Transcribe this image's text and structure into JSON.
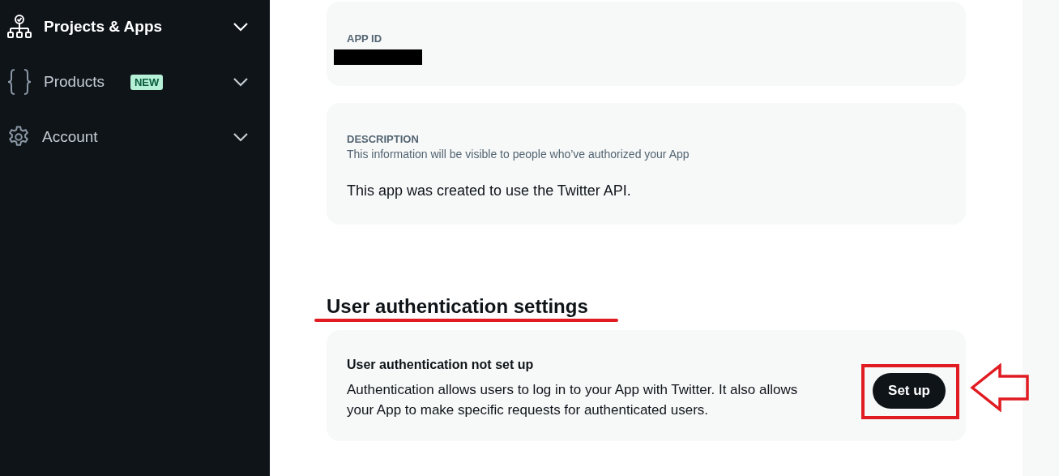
{
  "sidebar": {
    "items": [
      {
        "label": "Projects & Apps",
        "kind": "hierarchy",
        "selected": true
      },
      {
        "label": "Products",
        "kind": "braces",
        "badge": "NEW",
        "selected": false
      },
      {
        "label": "Account",
        "kind": "gear",
        "selected": false
      }
    ]
  },
  "app_id": {
    "label": "APP ID",
    "redacted": true
  },
  "description": {
    "label": "DESCRIPTION",
    "hint": "This information will be visible to people who’ve authorized your App",
    "value": "This app was created to use the Twitter API."
  },
  "user_auth": {
    "heading": "User authentication settings",
    "status_title": "User authentication not set up",
    "text": "Authentication allows users to log in to your App with Twitter. It also allows your App to make specific requests for authenticated users.",
    "button": "Set up"
  },
  "annotations": {
    "underline": true,
    "button_frame": true,
    "arrow": true
  }
}
